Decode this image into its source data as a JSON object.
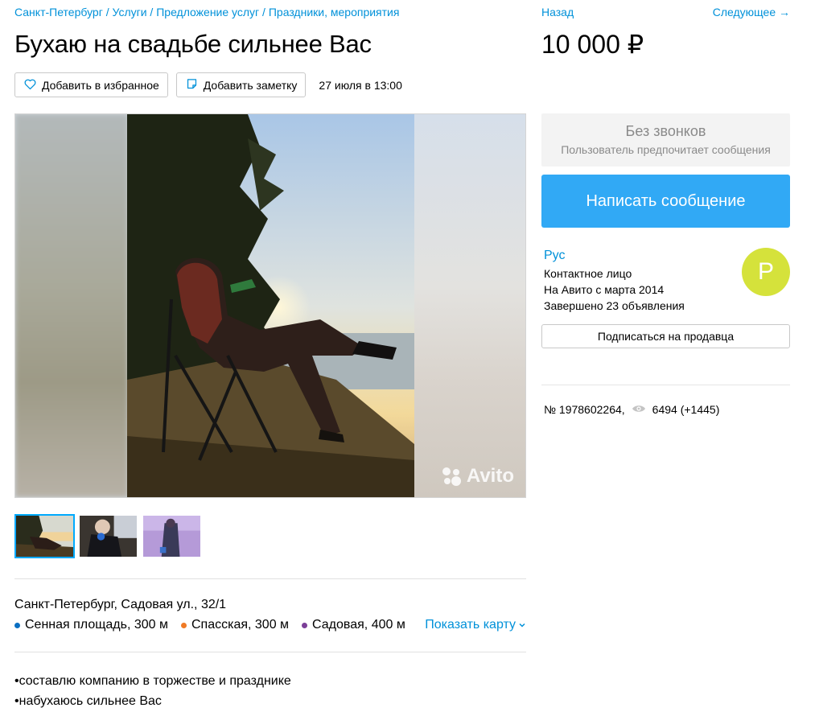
{
  "breadcrumbs": [
    {
      "label": "Санкт-Петербург"
    },
    {
      "label": "Услуги"
    },
    {
      "label": "Предложение услуг"
    },
    {
      "label": "Праздники, мероприятия"
    }
  ],
  "breadcrumb_separator": " / ",
  "title": "Бухаю на свадьбе сильнее Вас",
  "actions": {
    "favorite_label": "Добавить в избранное",
    "note_label": "Добавить заметку",
    "date": "27 июля в 13:00"
  },
  "gallery": {
    "watermark": "Avito",
    "thumbnails_count": 3
  },
  "location": {
    "address": "Санкт-Петербург, Садовая ул., 32/1",
    "stations": [
      {
        "name": "Сенная площадь, 300 м",
        "color": "#0a6fc2"
      },
      {
        "name": "Спасская, 300 м",
        "color": "#f07a25"
      },
      {
        "name": "Садовая, 400 м",
        "color": "#7b3f98"
      }
    ],
    "show_map_label": "Показать карту"
  },
  "description": [
    "•составлю компанию в торжестве и празднике",
    "•набухаюсь сильнее Вас"
  ],
  "nav": {
    "back_label": "Назад",
    "next_label": "Следующее →"
  },
  "price": "10 000 ₽",
  "no_calls": {
    "title": "Без звонков",
    "subtitle": "Пользователь предпочитает сообщения"
  },
  "write_button_label": "Написать сообщение",
  "seller": {
    "name": "Рус",
    "role": "Контактное лицо",
    "since": "На Авито с марта 2014",
    "completed": "Завершено 23 объявления",
    "avatar_letter": "Р",
    "avatar_color": "#d5e23b"
  },
  "subscribe_label": "Подписаться на продавца",
  "meta": {
    "ad_number": "№ 1978602264,",
    "views": "6494 (+1445)"
  },
  "colors": {
    "link": "#0091d9",
    "primary_button": "#31a9f5",
    "active_thumb_border": "#00aaff"
  }
}
